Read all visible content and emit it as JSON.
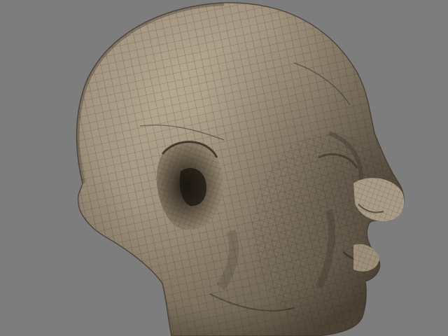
{
  "scene": {
    "background_color": "#7d7d7d",
    "skin_light": "#b8ab93",
    "skin_mid": "#8c806c",
    "skin_dark": "#4a4034",
    "wire_color": "#2a231c",
    "icon": "wireframe-head-mesh-icon"
  }
}
